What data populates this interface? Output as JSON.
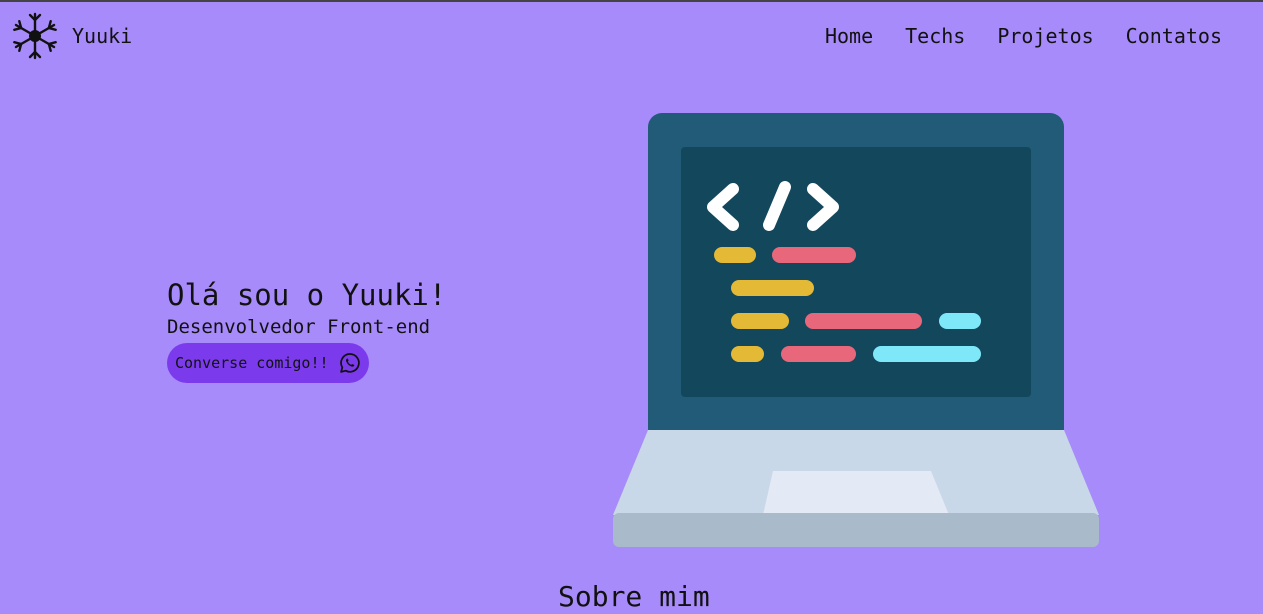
{
  "header": {
    "brand": "Yuuki",
    "logo_icon": "snowflake-icon",
    "nav": [
      {
        "label": "Home"
      },
      {
        "label": "Techs"
      },
      {
        "label": "Projetos"
      },
      {
        "label": "Contatos"
      }
    ]
  },
  "hero": {
    "title": "Olá sou o Yuuki!",
    "subtitle": "Desenvolvedor Front-end",
    "cta_label": "Converse comigo!!",
    "cta_icon": "whatsapp-icon",
    "illustration": "laptop-code-icon"
  },
  "about": {
    "title": "Sobre mim"
  },
  "colors": {
    "background": "#a78bfa",
    "cta": "#7c3aed",
    "laptop_frame": "#215b77",
    "laptop_screen": "#13475c",
    "code_yellow": "#e3b935",
    "code_red": "#e9677a",
    "code_cyan": "#7ee8f8"
  }
}
